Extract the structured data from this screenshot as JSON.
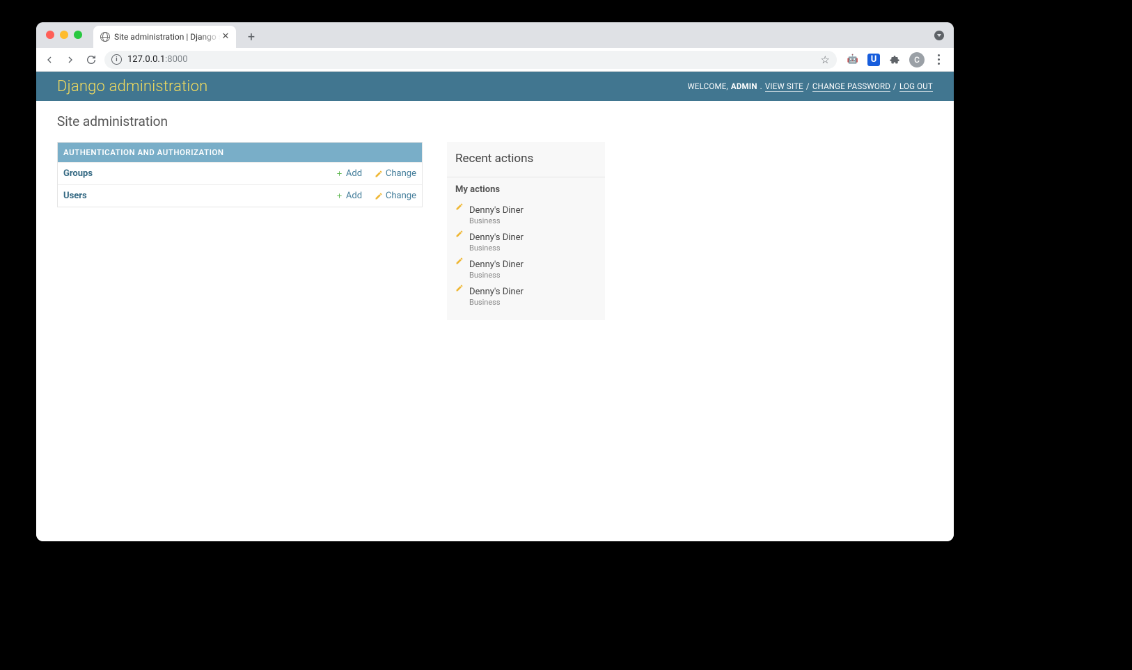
{
  "browser": {
    "tab_title": "Site administration | Django site",
    "url_host": "127.0.0.1",
    "url_port": ":8000",
    "avatar_initial": "C"
  },
  "header": {
    "title": "Django administration",
    "welcome_prefix": "WELCOME, ",
    "username": "ADMIN",
    "dot": ". ",
    "view_site": "VIEW SITE",
    "change_password": "CHANGE PASSWORD",
    "log_out": "LOG OUT",
    "sep": " / "
  },
  "page": {
    "title": "Site administration"
  },
  "app": {
    "name": "AUTHENTICATION AND AUTHORIZATION",
    "models": [
      {
        "name": "Groups",
        "add": "Add",
        "change": "Change"
      },
      {
        "name": "Users",
        "add": "Add",
        "change": "Change"
      }
    ]
  },
  "recent": {
    "title": "Recent actions",
    "subtitle": "My actions",
    "items": [
      {
        "name": "Denny's Diner",
        "type": "Business"
      },
      {
        "name": "Denny's Diner",
        "type": "Business"
      },
      {
        "name": "Denny's Diner",
        "type": "Business"
      },
      {
        "name": "Denny's Diner",
        "type": "Business"
      }
    ]
  }
}
